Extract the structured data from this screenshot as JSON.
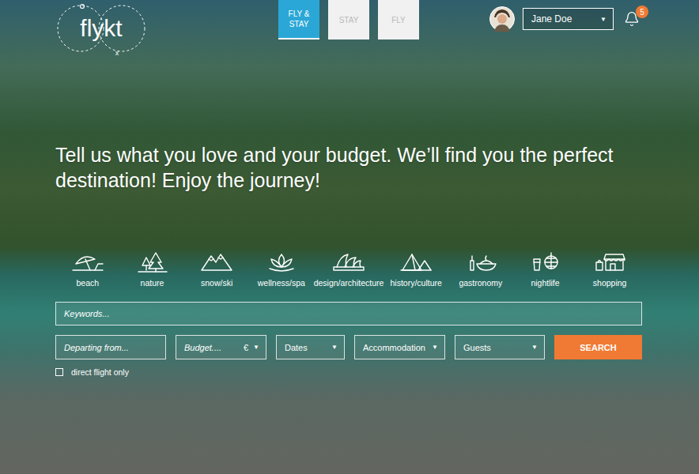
{
  "logo": {
    "text": "flykt",
    "mark": "x"
  },
  "tabs": [
    {
      "label": "FLY & STAY",
      "selected": true
    },
    {
      "label": "STAY",
      "selected": false
    },
    {
      "label": "FLY",
      "selected": false
    }
  ],
  "user": {
    "name": "Jane Doe",
    "arrow": "▼"
  },
  "notifications": {
    "count": "5"
  },
  "headline": "Tell us what you love and your budget. We’ll find you the perfect destination! Enjoy the journey!",
  "categories": [
    {
      "label": "beach"
    },
    {
      "label": "nature"
    },
    {
      "label": "snow/ski"
    },
    {
      "label": "wellness/spa"
    },
    {
      "label": "design/architecture"
    },
    {
      "label": "history/culture"
    },
    {
      "label": "gastronomy"
    },
    {
      "label": "nightlife"
    },
    {
      "label": "shopping"
    }
  ],
  "search": {
    "placeholder": "Keywords..."
  },
  "fields": [
    {
      "label": "Departing from...",
      "kind": "text"
    },
    {
      "label": "Budget....",
      "kind": "currency",
      "suffix": "€"
    },
    {
      "label": "Dates",
      "kind": "select"
    },
    {
      "label": "Accommodation",
      "kind": "select"
    },
    {
      "label": "Guests",
      "kind": "select"
    }
  ],
  "dropdown_arrow": "▼",
  "search_button": "SEARCH",
  "direct_flight": {
    "label": "direct flight only",
    "checked": false
  }
}
